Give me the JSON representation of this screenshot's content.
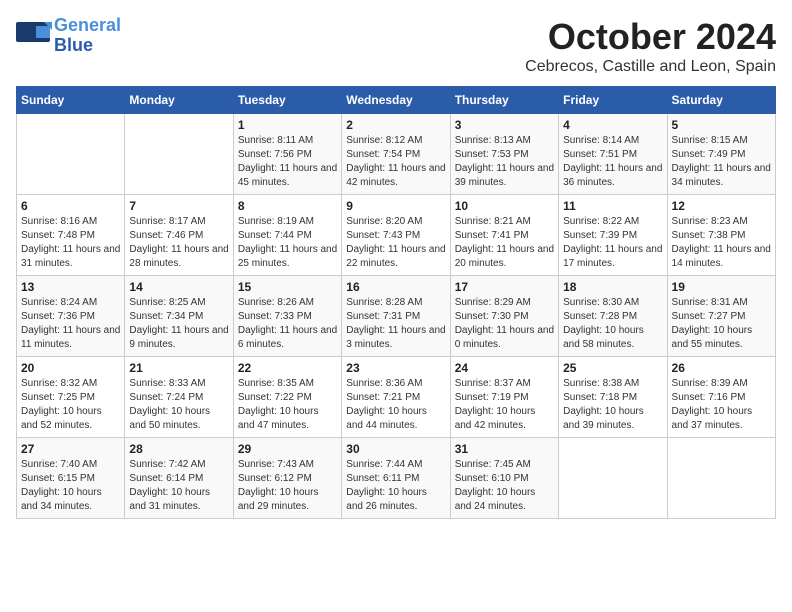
{
  "header": {
    "logo_line1": "General",
    "logo_line2": "Blue",
    "month_title": "October 2024",
    "subtitle": "Cebrecos, Castille and Leon, Spain"
  },
  "days_of_week": [
    "Sunday",
    "Monday",
    "Tuesday",
    "Wednesday",
    "Thursday",
    "Friday",
    "Saturday"
  ],
  "weeks": [
    [
      {
        "day": "",
        "info": ""
      },
      {
        "day": "",
        "info": ""
      },
      {
        "day": "1",
        "info": "Sunrise: 8:11 AM\nSunset: 7:56 PM\nDaylight: 11 hours and 45 minutes."
      },
      {
        "day": "2",
        "info": "Sunrise: 8:12 AM\nSunset: 7:54 PM\nDaylight: 11 hours and 42 minutes."
      },
      {
        "day": "3",
        "info": "Sunrise: 8:13 AM\nSunset: 7:53 PM\nDaylight: 11 hours and 39 minutes."
      },
      {
        "day": "4",
        "info": "Sunrise: 8:14 AM\nSunset: 7:51 PM\nDaylight: 11 hours and 36 minutes."
      },
      {
        "day": "5",
        "info": "Sunrise: 8:15 AM\nSunset: 7:49 PM\nDaylight: 11 hours and 34 minutes."
      }
    ],
    [
      {
        "day": "6",
        "info": "Sunrise: 8:16 AM\nSunset: 7:48 PM\nDaylight: 11 hours and 31 minutes."
      },
      {
        "day": "7",
        "info": "Sunrise: 8:17 AM\nSunset: 7:46 PM\nDaylight: 11 hours and 28 minutes."
      },
      {
        "day": "8",
        "info": "Sunrise: 8:19 AM\nSunset: 7:44 PM\nDaylight: 11 hours and 25 minutes."
      },
      {
        "day": "9",
        "info": "Sunrise: 8:20 AM\nSunset: 7:43 PM\nDaylight: 11 hours and 22 minutes."
      },
      {
        "day": "10",
        "info": "Sunrise: 8:21 AM\nSunset: 7:41 PM\nDaylight: 11 hours and 20 minutes."
      },
      {
        "day": "11",
        "info": "Sunrise: 8:22 AM\nSunset: 7:39 PM\nDaylight: 11 hours and 17 minutes."
      },
      {
        "day": "12",
        "info": "Sunrise: 8:23 AM\nSunset: 7:38 PM\nDaylight: 11 hours and 14 minutes."
      }
    ],
    [
      {
        "day": "13",
        "info": "Sunrise: 8:24 AM\nSunset: 7:36 PM\nDaylight: 11 hours and 11 minutes."
      },
      {
        "day": "14",
        "info": "Sunrise: 8:25 AM\nSunset: 7:34 PM\nDaylight: 11 hours and 9 minutes."
      },
      {
        "day": "15",
        "info": "Sunrise: 8:26 AM\nSunset: 7:33 PM\nDaylight: 11 hours and 6 minutes."
      },
      {
        "day": "16",
        "info": "Sunrise: 8:28 AM\nSunset: 7:31 PM\nDaylight: 11 hours and 3 minutes."
      },
      {
        "day": "17",
        "info": "Sunrise: 8:29 AM\nSunset: 7:30 PM\nDaylight: 11 hours and 0 minutes."
      },
      {
        "day": "18",
        "info": "Sunrise: 8:30 AM\nSunset: 7:28 PM\nDaylight: 10 hours and 58 minutes."
      },
      {
        "day": "19",
        "info": "Sunrise: 8:31 AM\nSunset: 7:27 PM\nDaylight: 10 hours and 55 minutes."
      }
    ],
    [
      {
        "day": "20",
        "info": "Sunrise: 8:32 AM\nSunset: 7:25 PM\nDaylight: 10 hours and 52 minutes."
      },
      {
        "day": "21",
        "info": "Sunrise: 8:33 AM\nSunset: 7:24 PM\nDaylight: 10 hours and 50 minutes."
      },
      {
        "day": "22",
        "info": "Sunrise: 8:35 AM\nSunset: 7:22 PM\nDaylight: 10 hours and 47 minutes."
      },
      {
        "day": "23",
        "info": "Sunrise: 8:36 AM\nSunset: 7:21 PM\nDaylight: 10 hours and 44 minutes."
      },
      {
        "day": "24",
        "info": "Sunrise: 8:37 AM\nSunset: 7:19 PM\nDaylight: 10 hours and 42 minutes."
      },
      {
        "day": "25",
        "info": "Sunrise: 8:38 AM\nSunset: 7:18 PM\nDaylight: 10 hours and 39 minutes."
      },
      {
        "day": "26",
        "info": "Sunrise: 8:39 AM\nSunset: 7:16 PM\nDaylight: 10 hours and 37 minutes."
      }
    ],
    [
      {
        "day": "27",
        "info": "Sunrise: 7:40 AM\nSunset: 6:15 PM\nDaylight: 10 hours and 34 minutes."
      },
      {
        "day": "28",
        "info": "Sunrise: 7:42 AM\nSunset: 6:14 PM\nDaylight: 10 hours and 31 minutes."
      },
      {
        "day": "29",
        "info": "Sunrise: 7:43 AM\nSunset: 6:12 PM\nDaylight: 10 hours and 29 minutes."
      },
      {
        "day": "30",
        "info": "Sunrise: 7:44 AM\nSunset: 6:11 PM\nDaylight: 10 hours and 26 minutes."
      },
      {
        "day": "31",
        "info": "Sunrise: 7:45 AM\nSunset: 6:10 PM\nDaylight: 10 hours and 24 minutes."
      },
      {
        "day": "",
        "info": ""
      },
      {
        "day": "",
        "info": ""
      }
    ]
  ]
}
